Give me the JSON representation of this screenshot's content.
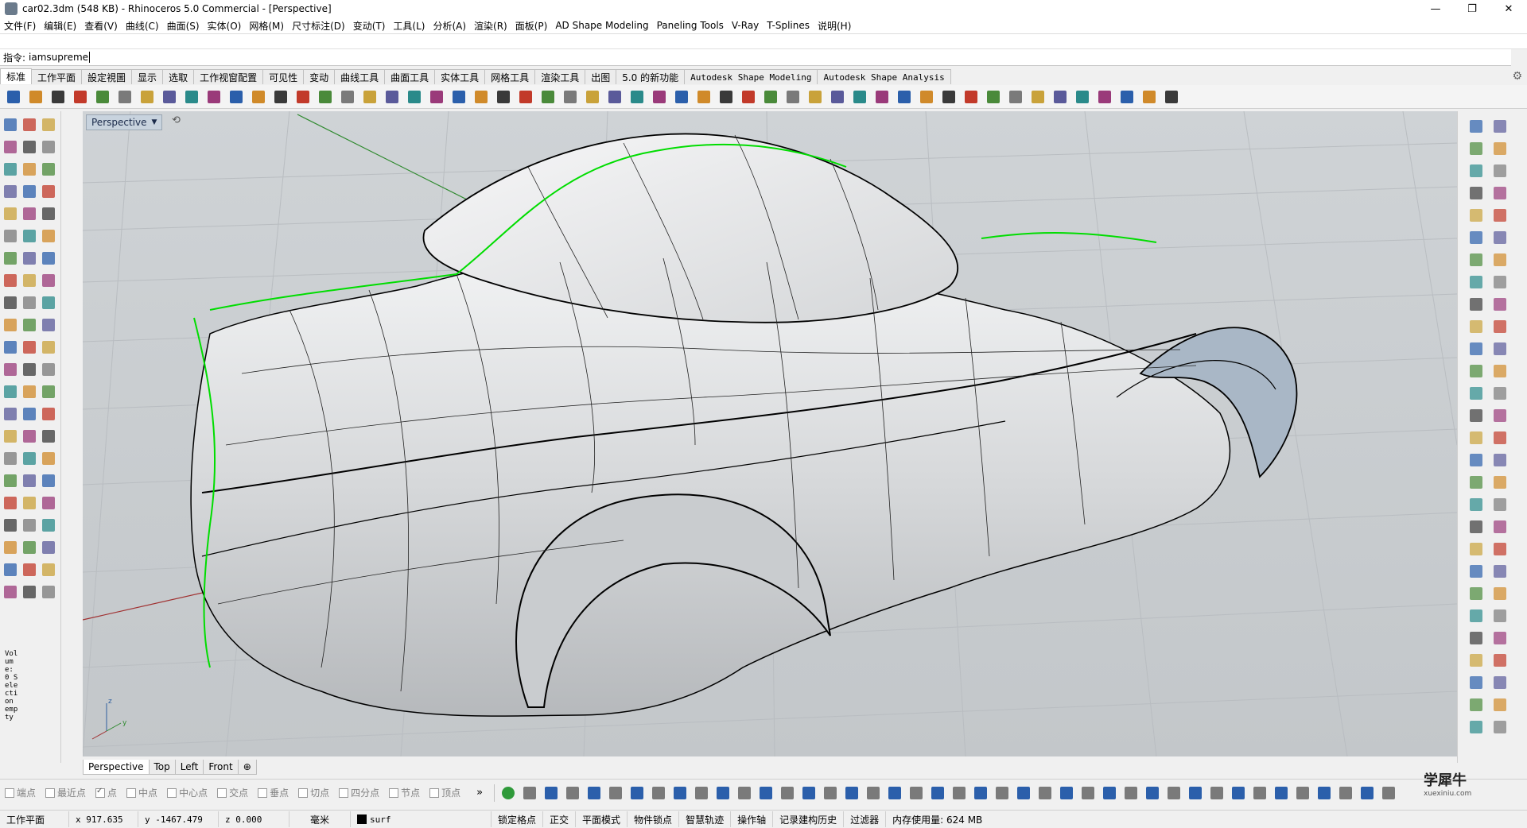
{
  "window": {
    "title": "car02.3dm (548 KB) - Rhinoceros 5.0 Commercial - [Perspective]",
    "controls": [
      "—",
      "❐",
      "✕"
    ]
  },
  "menu": [
    "文件(F)",
    "编辑(E)",
    "查看(V)",
    "曲线(C)",
    "曲面(S)",
    "实体(O)",
    "网格(M)",
    "尺寸标注(D)",
    "变动(T)",
    "工具(L)",
    "分析(A)",
    "渲染(R)",
    "面板(P)",
    "AD Shape Modeling",
    "Paneling Tools",
    "V-Ray",
    "T-Splines",
    "说明(H)"
  ],
  "command": {
    "label": "指令:",
    "value": "iamsupreme"
  },
  "toolbar_tabs": [
    "标准",
    "工作平面",
    "設定視圖",
    "显示",
    "选取",
    "工作视窗配置",
    "可见性",
    "变动",
    "曲线工具",
    "曲面工具",
    "实体工具",
    "网格工具",
    "渲染工具",
    "出图",
    "5.0 的新功能",
    "Autodesk Shape Modeling",
    "Autodesk Shape Analysis"
  ],
  "viewport": {
    "name": "Perspective"
  },
  "left_panel_text": "Volume: 0 Selection empty",
  "view_tabs": [
    "Perspective",
    "Top",
    "Left",
    "Front",
    "⊕"
  ],
  "osnaps": [
    {
      "label": "端点",
      "checked": false
    },
    {
      "label": "最近点",
      "checked": false
    },
    {
      "label": "点",
      "checked": true
    },
    {
      "label": "中点",
      "checked": false
    },
    {
      "label": "中心点",
      "checked": false
    },
    {
      "label": "交点",
      "checked": false
    },
    {
      "label": "垂点",
      "checked": false
    },
    {
      "label": "切点",
      "checked": false
    },
    {
      "label": "四分点",
      "checked": false
    },
    {
      "label": "节点",
      "checked": false
    },
    {
      "label": "顶点",
      "checked": false
    }
  ],
  "osnap_more": "»",
  "status": {
    "cplane": "工作平面",
    "x": "x 917.635",
    "y": "y -1467.479",
    "z": "z 0.000",
    "units": "毫米",
    "layer": "surf",
    "grid_snap": "锁定格点",
    "ortho": "正交",
    "planar": "平面模式",
    "osnap": "物件锁点",
    "smart_track": "智慧轨迹",
    "gumball": "操作轴",
    "history": "记录建构历史",
    "filter": "过滤器",
    "memory": "内存使用量: 624 MB"
  },
  "watermark": {
    "title": "学犀牛",
    "url": "xuexiniu.com"
  },
  "colors": {
    "viewport_bg": "#c9cccf",
    "grid": "#b8bcc0",
    "x_axis": "#a03030",
    "y_axis": "#2f8a2f",
    "highlight_curve": "#00dd00",
    "surface": "#e6e7e9"
  },
  "icons": {
    "main_toolbar": [
      "new-icon",
      "open-icon",
      "save-icon",
      "print-icon",
      "import-icon",
      "cut-icon",
      "copy-icon",
      "paste-icon",
      "undo-icon",
      "pan-icon",
      "rotate-view-icon",
      "zoom-icon",
      "zoom-window-icon",
      "zoom-extents-icon",
      "zoom-selected-icon",
      "rotate-icon",
      "zoom-all-icon",
      "zoom-extents-all-icon",
      "zoom-selected-all-icon",
      "four-viewports-icon",
      "set-cplane-icon",
      "cplane-icon",
      "car-icon",
      "car-icon",
      "car-icon",
      "car-icon",
      "car-icon",
      "car-icon",
      "car-icon",
      "light-icon",
      "orbit-icon",
      "rectangle-icon",
      "layer-icon",
      "properties-icon",
      "sphere-icon",
      "pencil-icon",
      "select-icon",
      "light-bulb-icon",
      "lock-icon",
      "render-icon",
      "color-wheel-icon",
      "material-icon",
      "environment-icon",
      "texture-icon",
      "help-icon",
      "option-icon",
      "command-icon",
      "camera-icon",
      "record-icon",
      "globe-icon",
      "settings-icon",
      "golf-icon",
      "grid-icon"
    ]
  }
}
